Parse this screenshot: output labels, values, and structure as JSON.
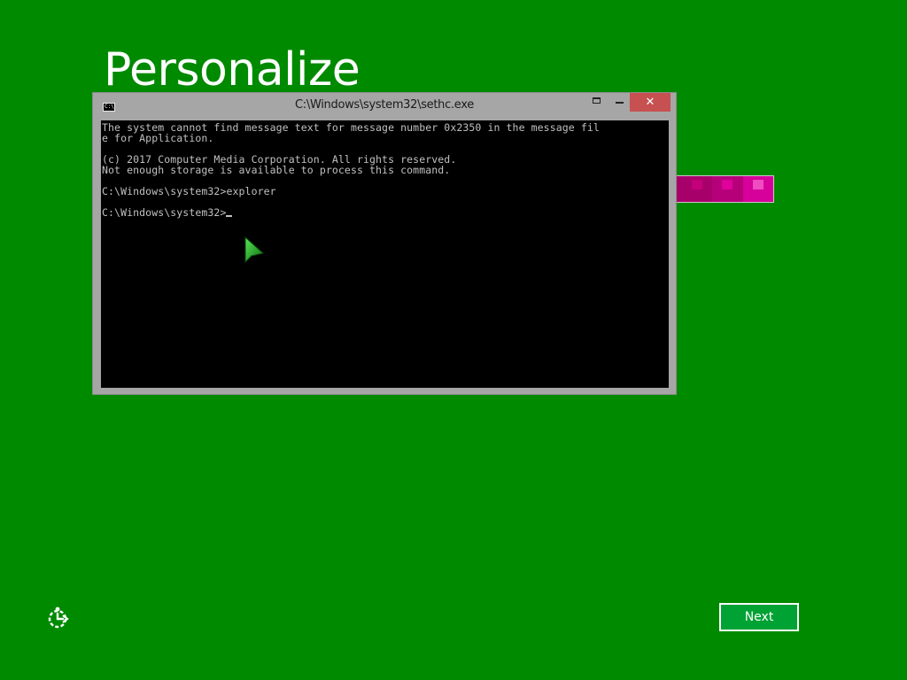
{
  "page": {
    "title": "Personalize",
    "next_label": "Next"
  },
  "icons": {
    "accessibility": "ease-of-access-icon",
    "pointer": "mouse-pointer-icon",
    "console_app": "console-app-icon",
    "minimize": "minimize-icon",
    "maximize": "maximize-icon",
    "close": "close-icon"
  },
  "colors": {
    "background": "#008a00",
    "next_button": "#00a234",
    "console_bg": "#000000",
    "console_text": "#c0c0c0",
    "close_button": "#c75050"
  },
  "swatches": [
    {
      "color": "#9b2fb0",
      "chip": "#c24bd8"
    },
    {
      "color": "#a8006b",
      "chip": "#a8006b"
    },
    {
      "color": "#a8006b",
      "chip": "#c3007a"
    },
    {
      "color": "#b5007a",
      "chip": "#e0009a"
    },
    {
      "color": "#d6009b",
      "chip": "#f04cc1"
    }
  ],
  "console": {
    "title": "C:\\Windows\\system32\\sethc.exe",
    "icon_text": "C:\\",
    "close_glyph": "✕",
    "lines": [
      "The system cannot find message text for message number 0x2350 in the message fil",
      "e for Application.",
      "",
      "(c) 2017 Computer Media Corporation. All rights reserved.",
      "Not enough storage is available to process this command.",
      "",
      "C:\\Windows\\system32>explorer",
      "",
      "C:\\Windows\\system32>"
    ]
  }
}
